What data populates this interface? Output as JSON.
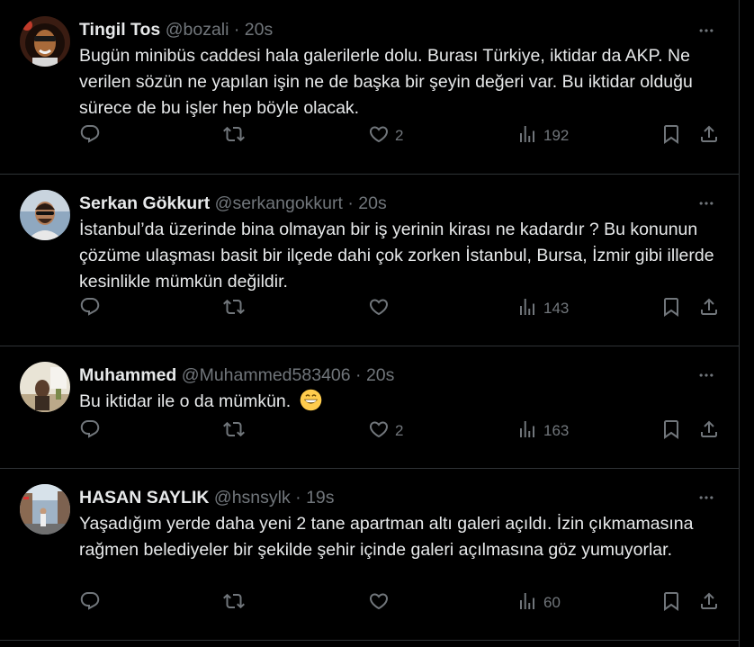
{
  "tweets": [
    {
      "name": "Tingil Tos",
      "handle": "@bozali",
      "dot": "·",
      "time": "20s",
      "text": "Bugün minibüs caddesi hala galerilerle dolu. Burası Türkiye, iktidar da AKP. Ne verilen sözün ne yapılan işin ne de başka bir şeyin değeri var. Bu iktidar olduğu sürece de bu işler hep böyle olacak.",
      "likes": "2",
      "views": "192"
    },
    {
      "name": "Serkan Gökkurt",
      "handle": "@serkangokkurt",
      "dot": "·",
      "time": "20s",
      "text": "İstanbul’da üzerinde bina olmayan bir iş yerinin kirası ne kadardır ? Bu konunun çözüme ulaşması basit bir ilçede dahi çok zorken İstanbul, Bursa, İzmir gibi illerde kesinlikle mümkün değildir.",
      "likes": "",
      "views": "143"
    },
    {
      "name": "Muhammed",
      "handle": "@Muhammed583406",
      "dot": "·",
      "time": "20s",
      "text": "Bu iktidar ile o da mümkün.",
      "likes": "2",
      "views": "163"
    },
    {
      "name": "HASAN SAYLIK",
      "handle": "@hsnsylk",
      "dot": "·",
      "time": "19s",
      "text": "Yaşadığım yerde daha yeni 2 tane apartman altı galeri açıldı. İzin çıkmamasına rağmen belediyeler bir şekilde şehir içinde galeri açılmasına göz yumuyorlar.",
      "likes": "",
      "views": "60"
    }
  ],
  "icons": {
    "reply": "reply-icon",
    "retweet": "retweet-icon",
    "like": "heart-icon",
    "views": "views-chart-icon",
    "bookmark": "bookmark-icon",
    "share": "share-icon",
    "more": "more-dots-icon",
    "emoji": "grinning-face-emoji"
  },
  "colors": {
    "background": "#000000",
    "text": "#e7e9ea",
    "muted": "#71767b",
    "divider": "#2f3336"
  }
}
